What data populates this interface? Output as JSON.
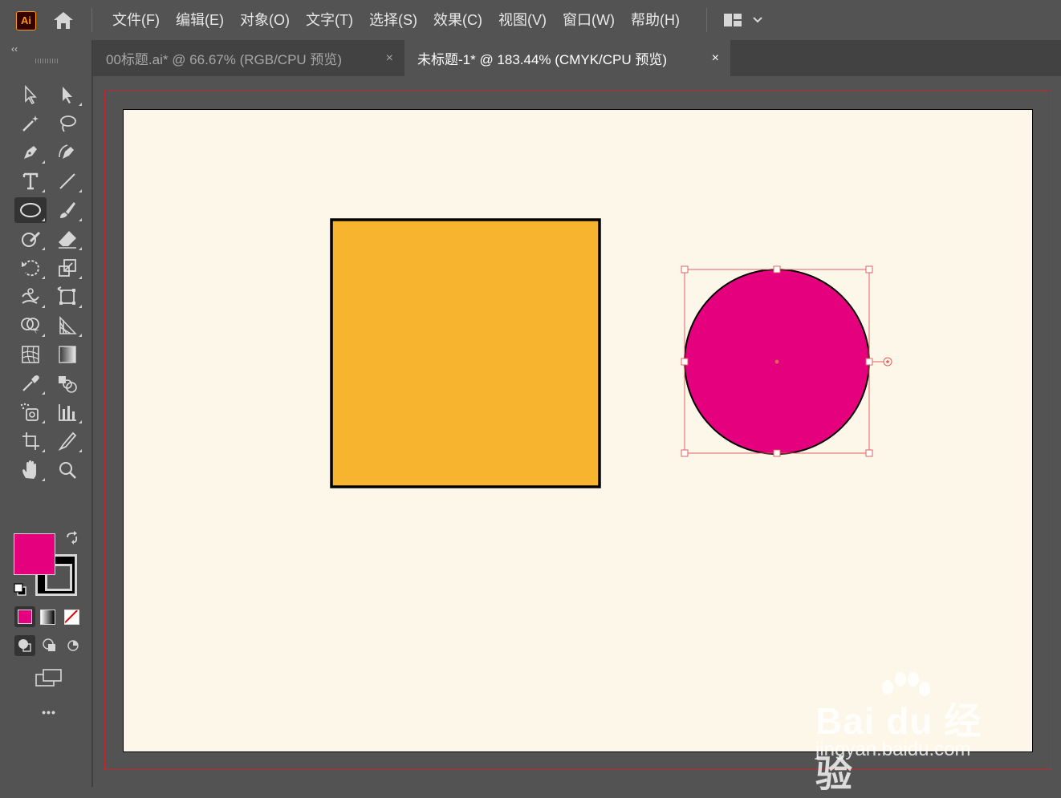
{
  "app": {
    "logo_text": "Ai"
  },
  "menu": {
    "items": [
      "文件(F)",
      "编辑(E)",
      "对象(O)",
      "文字(T)",
      "选择(S)",
      "效果(C)",
      "视图(V)",
      "窗口(W)",
      "帮助(H)"
    ]
  },
  "tabs": [
    {
      "label": "00标题.ai* @ 66.67% (RGB/CPU 预览)",
      "close": "×",
      "active": false
    },
    {
      "label": "未标题-1* @ 183.44% (CMYK/CPU 预览)",
      "close": "×",
      "active": true
    }
  ],
  "toolbar": {
    "collapse_glyph": "‹‹",
    "more_glyph": "•••",
    "active_tool": "ellipse-tool",
    "fill_color": "#e5007d",
    "stroke_color": "#000000"
  },
  "artwork": {
    "rectangle": {
      "fill": "#f7b52f",
      "stroke": "#000000"
    },
    "circle": {
      "fill": "#e5007d",
      "stroke": "#000000",
      "selected": true
    },
    "selection_color": "#e0615f"
  },
  "watermark": {
    "brand": "Bai du 经验",
    "url": "jingyan.baidu.com"
  }
}
